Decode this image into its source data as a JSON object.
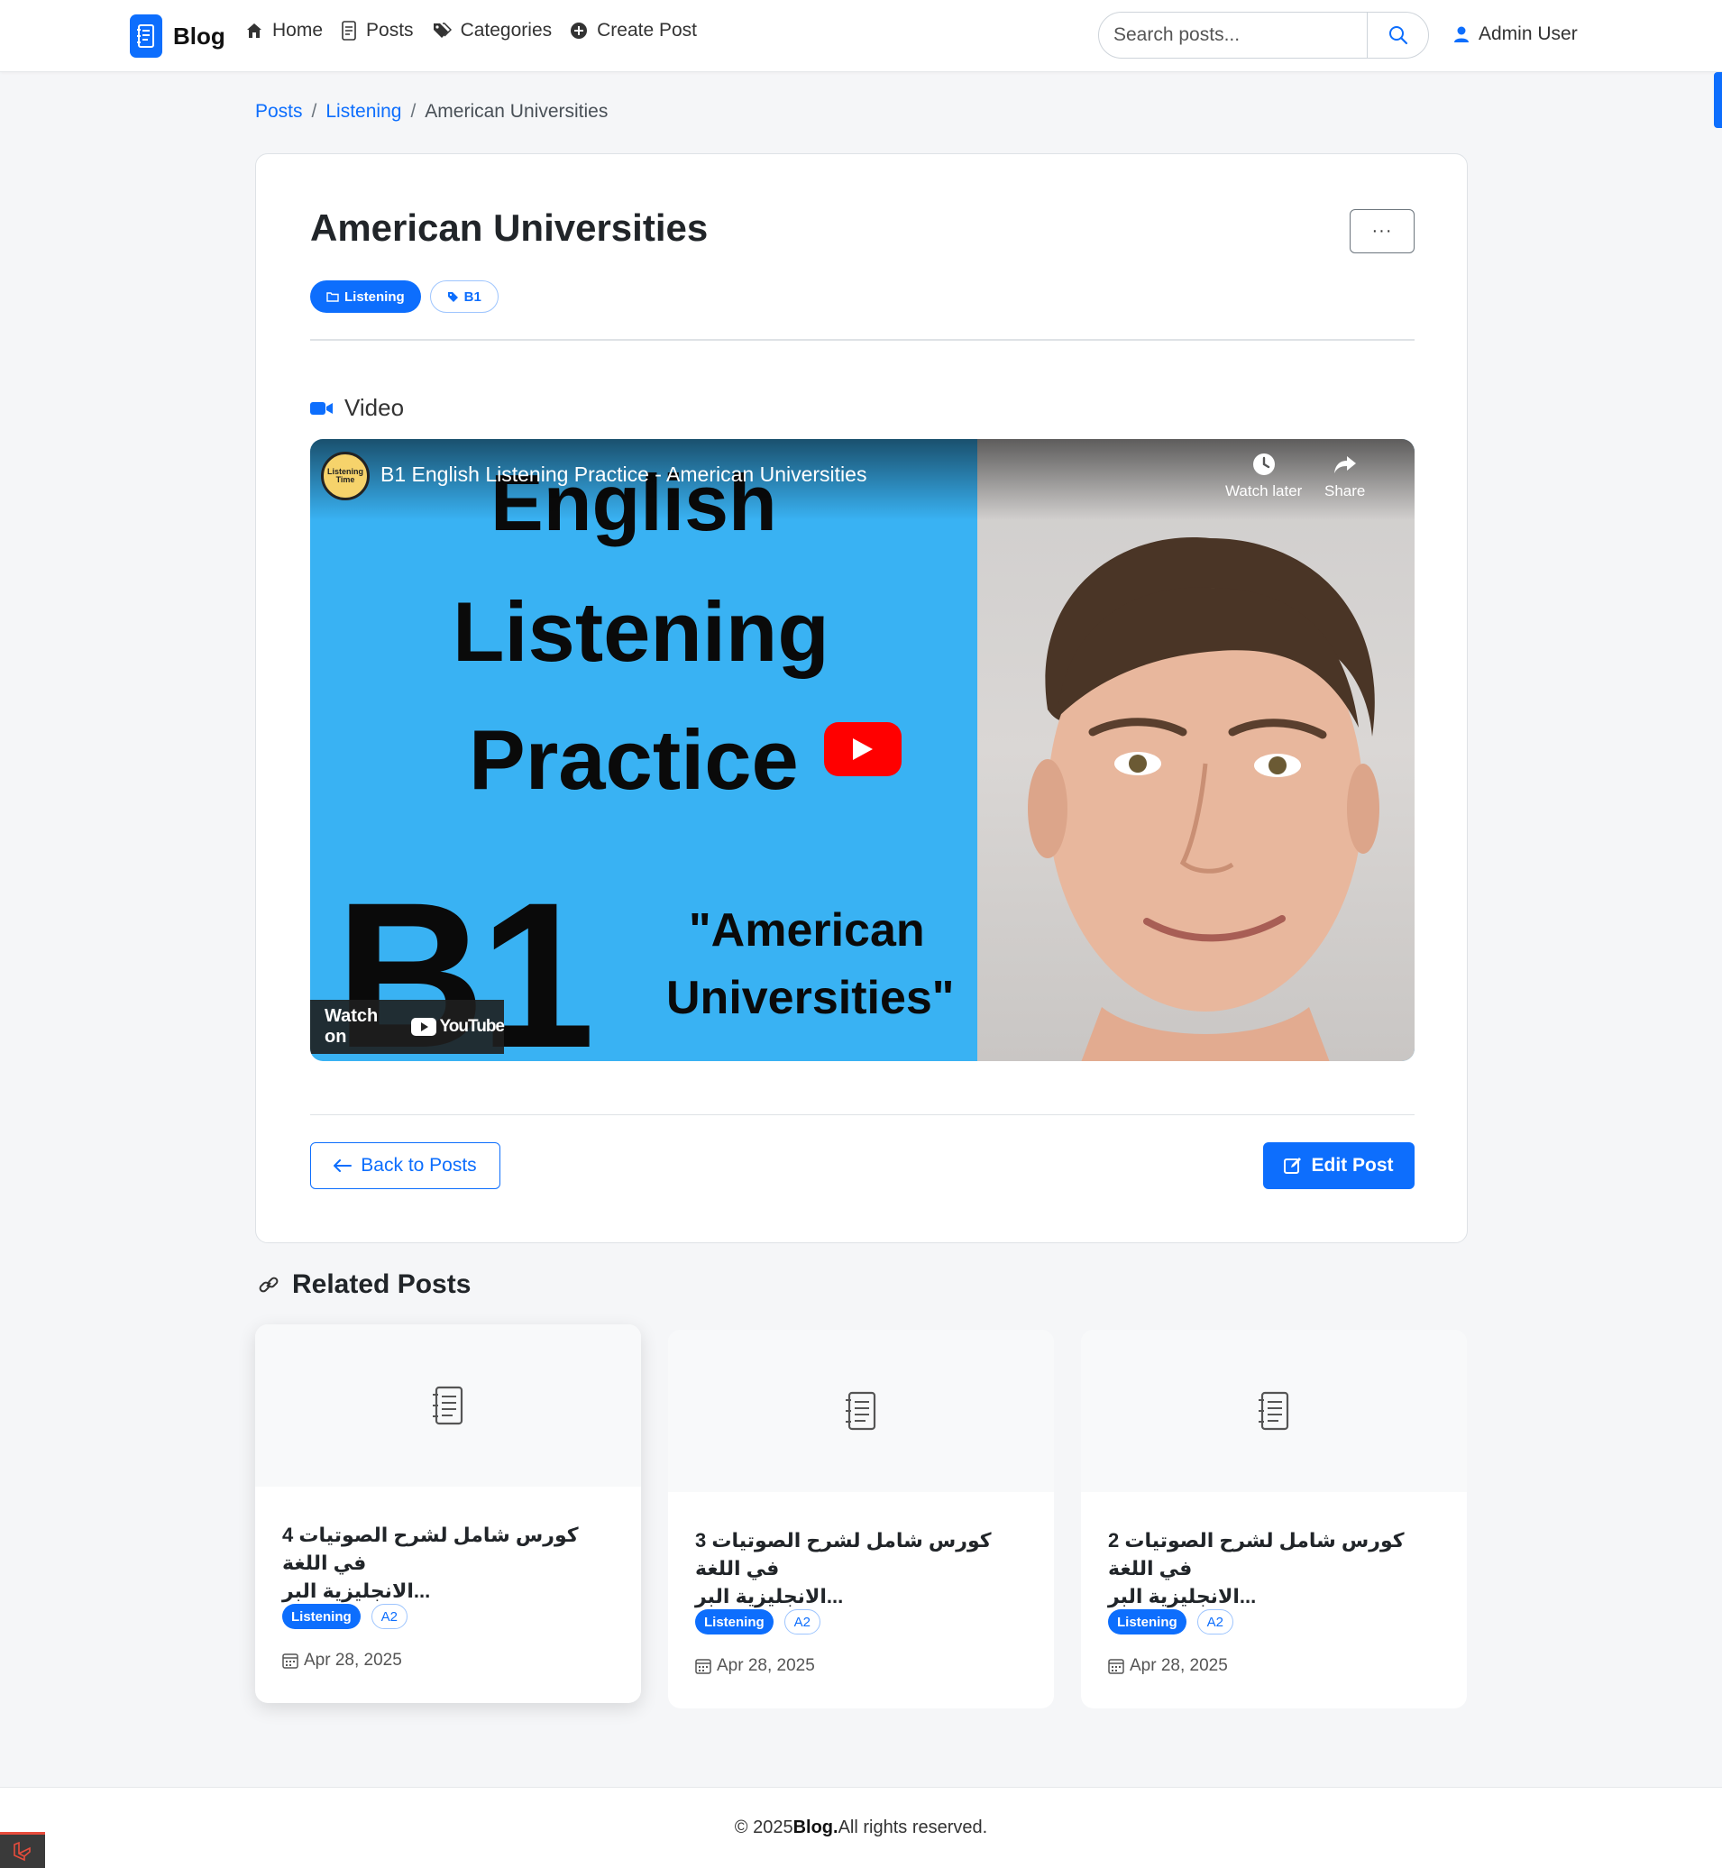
{
  "navbar": {
    "brand": "Blog",
    "links": [
      {
        "label": "Home",
        "icon": "home-icon"
      },
      {
        "label": "Posts",
        "icon": "file-text-icon"
      },
      {
        "label": "Categories",
        "icon": "tags-icon"
      },
      {
        "label": "Create Post",
        "icon": "plus-circle-icon"
      }
    ],
    "search_placeholder": "Search posts...",
    "user": "Admin User"
  },
  "breadcrumb": {
    "items": [
      "Posts",
      "Listening"
    ],
    "current": "American Universities"
  },
  "post": {
    "title": "American Universities",
    "category": "Listening",
    "level": "B1",
    "more_label": "···",
    "section_video": "Video"
  },
  "video": {
    "title": "B1 English Listening Practice - American Universities",
    "channel_logo": "Listening Time",
    "thumb_lines": [
      "English",
      "Listening",
      "Practice"
    ],
    "thumb_level": "B1",
    "thumb_quote_1": "\"American",
    "thumb_quote_2": "Universities\"",
    "watch_later": "Watch later",
    "share": "Share",
    "watch_on": "Watch on",
    "youtube": "YouTube"
  },
  "actions": {
    "back": "Back to Posts",
    "edit": "Edit Post"
  },
  "related": {
    "heading": "Related Posts",
    "posts": [
      {
        "title_line1": "4 كورس شامل لشرح الصوتيات في اللغة",
        "title_line2": "الانجليزية البر...",
        "category": "Listening",
        "level": "A2",
        "date": "Apr 28, 2025"
      },
      {
        "title_line1": "3 كورس شامل لشرح الصوتيات في اللغة",
        "title_line2": "الانجليزية البر...",
        "category": "Listening",
        "level": "A2",
        "date": "Apr 28, 2025"
      },
      {
        "title_line1": "2 كورس شامل لشرح الصوتيات في اللغة",
        "title_line2": "الانجليزية البر...",
        "category": "Listening",
        "level": "A2",
        "date": "Apr 28, 2025"
      }
    ]
  },
  "footer": {
    "prefix": "© 2025",
    "brand": "Blog.",
    "suffix": "All rights reserved."
  },
  "colors": {
    "primary": "#0d6efd",
    "video_bg": "#39b2f3",
    "youtube_red": "#ff0000"
  }
}
